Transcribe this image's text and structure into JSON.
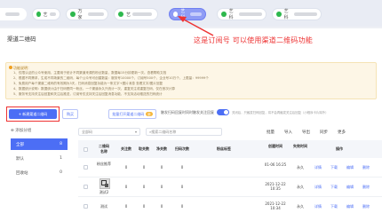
{
  "accounts": [
    {
      "label": "艺",
      "active": false
    },
    {
      "label": "万家",
      "active": false
    },
    {
      "label": "艺",
      "active": false
    },
    {
      "label": "艺科",
      "active": true
    },
    {
      "label": "艺科",
      "active": false
    },
    {
      "label": "艺科",
      "active": false
    }
  ],
  "page_title": "渠道二维码",
  "annotation": "这是订阅号 可以使用渠道二维码功能",
  "notice": {
    "title": "功能说明：",
    "lines": [
      "1、仅限认证的公众号使用，主要用于统计不同渠道来源的粉丝数量，数据每15分钟更新一次。查看帮助文档",
      "2、根据不同需求，生成不同场景的二维码，每个公众号可创建数量：服务号10000个，订阅号500个，企业号10万个，上限量：99999个",
      "3、免费用户每个渠道二维码的有效期为3天，扫码消息回复功能为一条文字+图片消息 查看文字/图片回复",
      "4、数据统计说明：数据统计由于扫码是同一粉丝，一个渠道永久只统计一次，重复关注或重复扫码，仅在首次计算",
      "5、服务号支持关注后回复和关注后推送，订阅号仅支持关注后回复消息功能，不支持活动推送的扫码统计"
    ]
  },
  "buttons": {
    "new_qr": "+ 新建渠道二维码",
    "buy": "购买",
    "batch": "批量打开渠道二维码",
    "batch_badge": "新",
    "toggle_label": "触发扫码回复时同时触发关注回复",
    "toggle_state": "关闭后，只触发扫码回复，将不会再触发关注后回复（小程序卡片除外）"
  },
  "sidebar": {
    "add_group": "添加分组",
    "items": [
      {
        "label": "全部",
        "count": "8"
      },
      {
        "label": "默认",
        "count": "1"
      },
      {
        "label": "回收站",
        "count": "0"
      }
    ]
  },
  "filters": {
    "select": "全部码",
    "search_placeholder": "搜索二维码名称",
    "batch_label": "批量",
    "import_label": "导入",
    "export_label": "导出",
    "sync_label": "同步",
    "more_label": "更多"
  },
  "table": {
    "headers": [
      "",
      "二维码",
      "名称",
      "关注数",
      "取关数",
      "净关数",
      "扫码次数",
      "粉丝标签",
      "创建时间",
      "失效时间",
      "操作"
    ],
    "rows": [
      {
        "name": "粉丝推荐",
        "follow": "0",
        "unfollow": "0",
        "net": "0",
        "scan": "0",
        "tags": "",
        "created": "01-06 16:25",
        "expire": "永久",
        "ops": [
          "详情",
          "下载",
          "编辑",
          "删除"
        ]
      },
      {
        "name": "测试2",
        "follow": "0",
        "unfollow": "0",
        "net": "0",
        "scan": "0",
        "tags": "",
        "created": "2021-12-22 10:35",
        "expire": "永久",
        "ops": [
          "详情",
          "下载",
          "编辑",
          "删除"
        ]
      },
      {
        "name": "测试",
        "follow": "0",
        "unfollow": "0",
        "net": "0",
        "scan": "0",
        "tags": "",
        "created": "2021-12-22 10:34",
        "expire": "永久",
        "ops": [
          "详情",
          "下载",
          "编辑",
          "删除"
        ]
      }
    ]
  },
  "colors": {
    "accent": "#4c6ef5",
    "annotation": "#ee3333",
    "warn_bg": "#fdf6e6"
  }
}
